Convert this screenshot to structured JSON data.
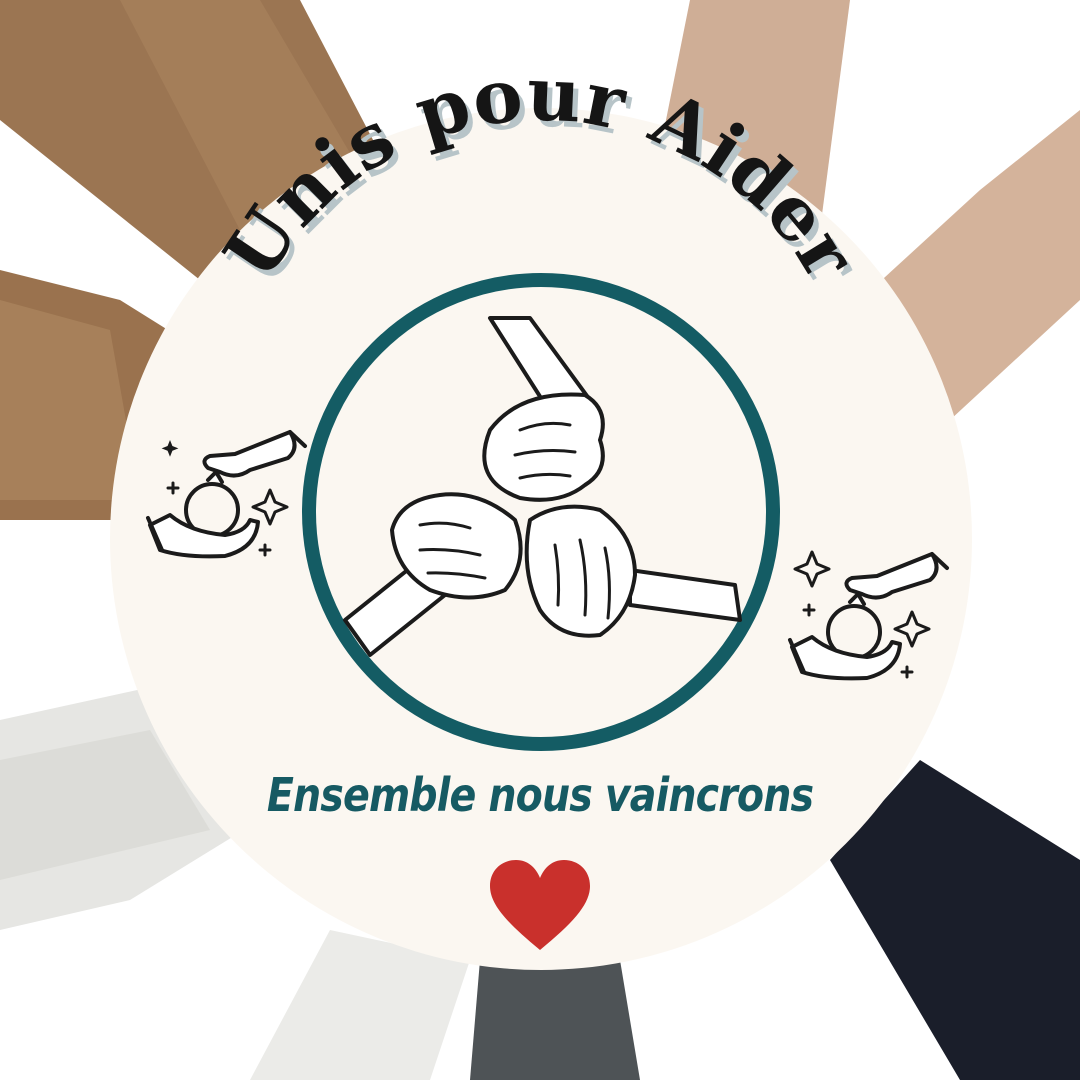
{
  "logo": {
    "title": "Unis pour Aider",
    "tagline": "Ensemble nous vaincrons"
  },
  "icons": {
    "center": "joined-hands-icon",
    "left": "giving-hands-icon",
    "right": "giving-hands-icon",
    "bottom": "heart-icon"
  },
  "colors": {
    "disc": "#fbf7f1",
    "ring": "#145c64",
    "title": "#151515",
    "title_shadow": "#b7c4c8",
    "tagline": "#165a63",
    "heart": "#c9302c",
    "sleeve_brown": "#9b7552",
    "skin": "#d7b59c",
    "sleeve_white": "#e9e9e6",
    "sleeve_navy": "#1a1e2a",
    "sleeve_grey": "#4e5356"
  }
}
